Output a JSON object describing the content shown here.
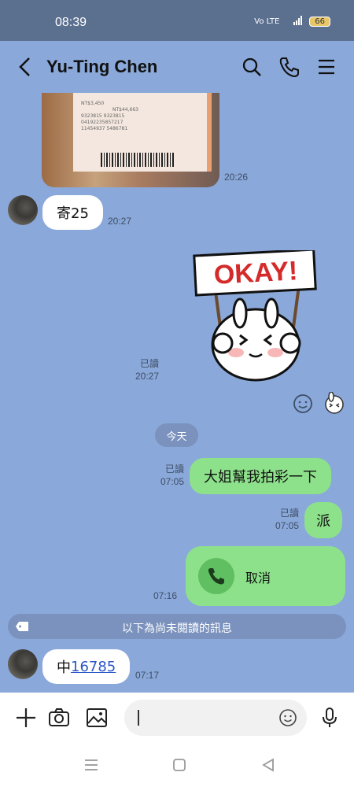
{
  "status_bar": {
    "time": "08:39",
    "network": "Vo LTE",
    "signal": "5G",
    "battery": "66"
  },
  "header": {
    "title": "Yu-Ting Chen"
  },
  "messages": {
    "image_time": "20:26",
    "receipt_text": [
      "NT$3,450",
      "NT$44,663",
      "9323815 9323815",
      "04192235857217",
      "11454937 5486781"
    ],
    "msg1_text": "寄25",
    "msg1_time": "20:27",
    "sticker_text": "OKAY!",
    "sticker_read": "已讀",
    "sticker_time": "20:27",
    "date_chip": "今天",
    "out1_text": "大姐幫我拍彩一下",
    "out1_read": "已讀",
    "out1_time": "07:05",
    "out2_text": "派",
    "out2_read": "已讀",
    "out2_time": "07:05",
    "call_label": "取消",
    "call_time": "07:16",
    "unread_banner": "以下為尚未閱讀的訊息",
    "last_prefix": "中",
    "last_link": "16785",
    "last_time": "07:17"
  },
  "input": {
    "placeholder": ""
  },
  "colors": {
    "chat_bg": "#8aa8d9",
    "outgoing": "#8de18b",
    "incoming": "#ffffff",
    "status_bar": "#5b6f8f"
  }
}
